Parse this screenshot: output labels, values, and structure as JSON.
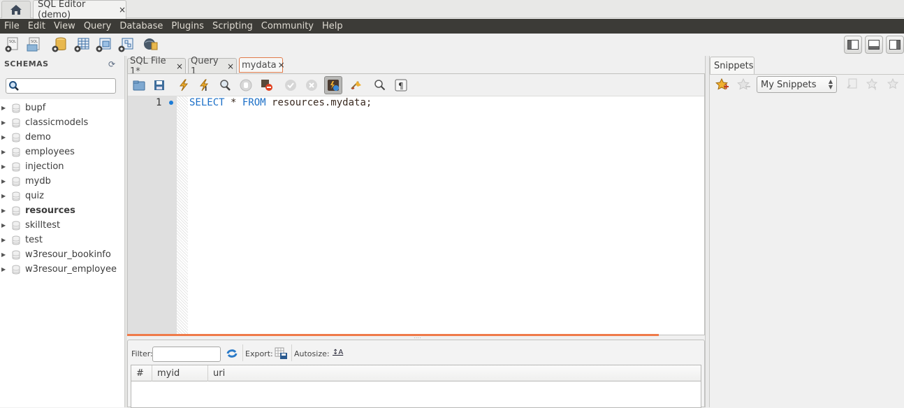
{
  "window": {
    "home_tab": "home",
    "doc_tab": {
      "label": "SQL Editor (demo)",
      "close": "×"
    }
  },
  "menubar": {
    "items": [
      "File",
      "Edit",
      "View",
      "Query",
      "Database",
      "Plugins",
      "Scripting",
      "Community",
      "Help"
    ]
  },
  "main_toolbar": {
    "icons": [
      "new-sql-tab-icon",
      "open-sql-script-icon",
      "create-schema-icon",
      "create-table-icon",
      "create-view-icon",
      "create-routine-icon",
      "reconnect-icon"
    ],
    "layout_buttons": [
      "toggle-sidebar",
      "toggle-output",
      "toggle-secondary-sidebar"
    ]
  },
  "sidebar": {
    "title": "SCHEMAS",
    "search": {
      "placeholder": "",
      "value": ""
    },
    "schemas": [
      {
        "name": "bupf",
        "bold": false
      },
      {
        "name": "classicmodels",
        "bold": false
      },
      {
        "name": "demo",
        "bold": false
      },
      {
        "name": "employees",
        "bold": false
      },
      {
        "name": "injection",
        "bold": false
      },
      {
        "name": "mydb",
        "bold": false
      },
      {
        "name": "quiz",
        "bold": false
      },
      {
        "name": "resources",
        "bold": true
      },
      {
        "name": "skilltest",
        "bold": false
      },
      {
        "name": "test",
        "bold": false
      },
      {
        "name": "w3resour_bookinfo",
        "bold": false
      },
      {
        "name": "w3resour_employee",
        "bold": false
      }
    ]
  },
  "editor": {
    "tabs": [
      {
        "label": "SQL File 1*",
        "close": "×",
        "active": false
      },
      {
        "label": "Query 1",
        "close": "×",
        "active": false
      },
      {
        "label": "mydata",
        "close": "×",
        "active": true
      }
    ],
    "line_number": "1",
    "code": {
      "kw1": "SELECT",
      "star": " * ",
      "kw2": "FROM",
      "rest": " resources.mydata;"
    },
    "toolbar_icons": [
      "open-file",
      "save",
      "execute",
      "execute-current",
      "explain",
      "stop",
      "toggle-continue-on-error",
      "commit",
      "rollback",
      "toggle-autocommit",
      "beautify",
      "find",
      "toggle-invisible-chars"
    ]
  },
  "results": {
    "filter_label": "Filter:",
    "filter_value": "",
    "export_label": "Export:",
    "autosize_label": "Autosize:",
    "columns": [
      "#",
      "myid",
      "uri"
    ]
  },
  "snippets": {
    "tab_label": "Snippets",
    "selected": "My Snippets"
  },
  "colors": {
    "menubar_bg": "#3c3b37",
    "accent_orange": "#ef7a49",
    "keyword_blue": "#1b6fc7"
  }
}
